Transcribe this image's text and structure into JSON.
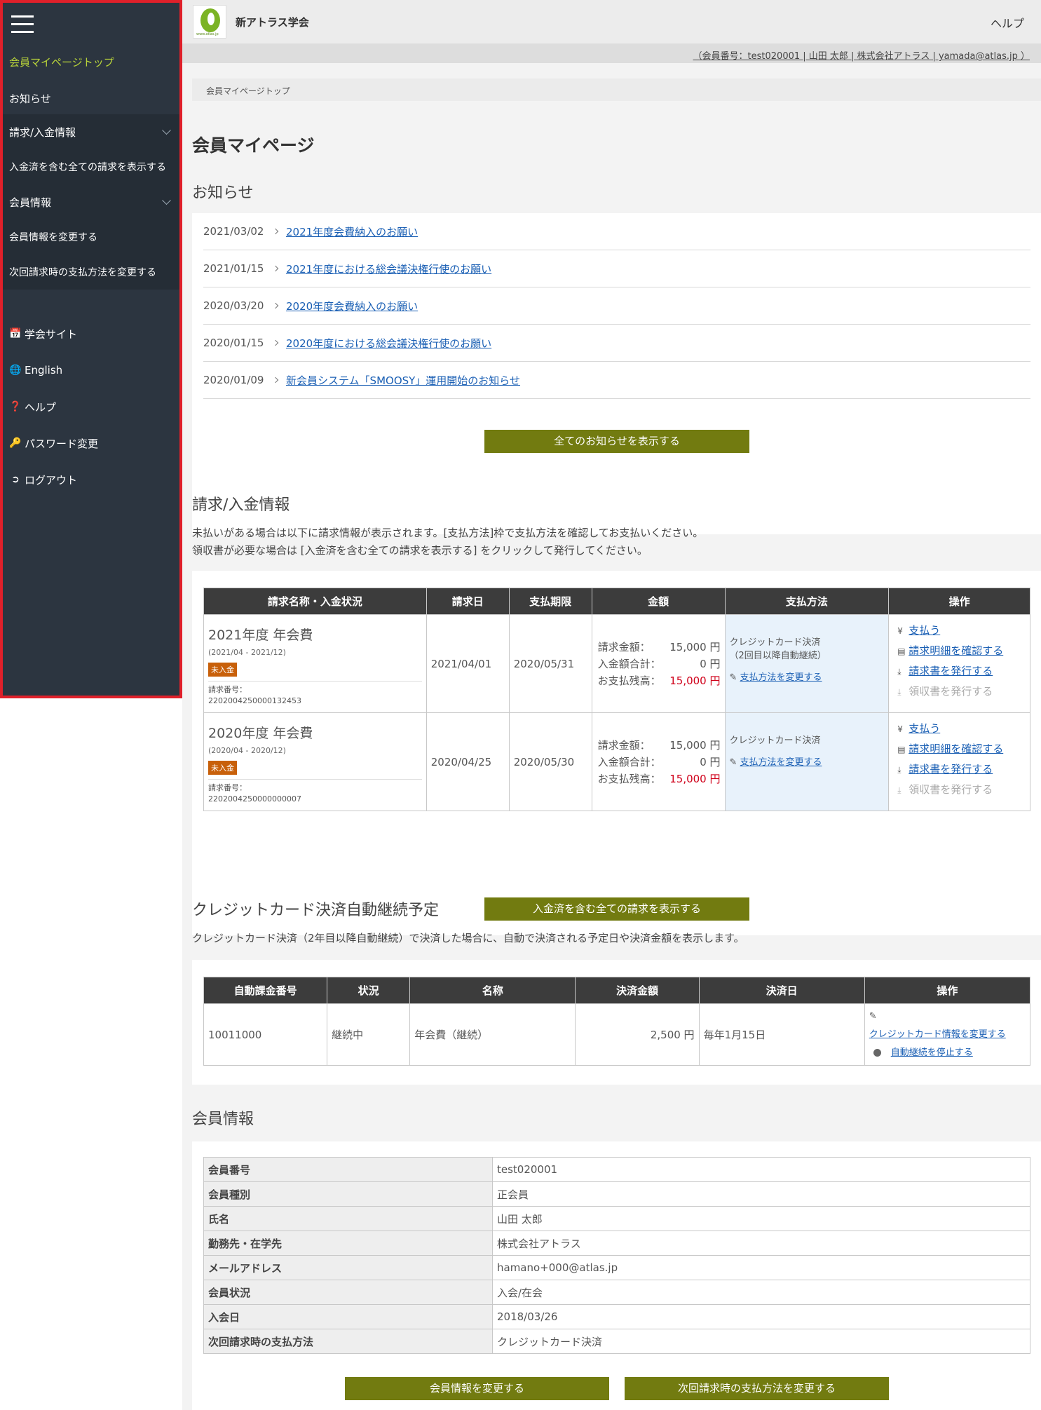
{
  "sidebar": {
    "items": [
      {
        "label": "会員マイページトップ"
      },
      {
        "label": "お知らせ"
      },
      {
        "label": "請求/入金情報"
      },
      {
        "label": "入金済を含む全ての請求を表示する"
      },
      {
        "label": "会員情報"
      },
      {
        "label": "会員情報を変更する"
      },
      {
        "label": "次回請求時の支払方法を変更する"
      }
    ],
    "links": [
      {
        "icon": "calendar-icon",
        "label": "学会サイト"
      },
      {
        "icon": "globe-icon",
        "label": "English"
      },
      {
        "icon": "question-icon",
        "label": "ヘルプ"
      },
      {
        "icon": "key-icon",
        "label": "パスワード変更"
      },
      {
        "icon": "logout-icon",
        "label": "ログアウト"
      }
    ]
  },
  "header": {
    "logo_url_text": "www.atlas.jp",
    "site_title": "新アトラス学会",
    "help": "ヘルプ",
    "user_info": "（会員番号：test020001 | 山田 太郎 | 株式会社アトラス | yamada@atlas.jp ）"
  },
  "breadcrumb": "会員マイページトップ",
  "page_title": "会員マイページ",
  "news": {
    "heading": "お知らせ",
    "items": [
      {
        "date": "2021/03/02",
        "title": "2021年度会費納入のお願い"
      },
      {
        "date": "2021/01/15",
        "title": "2021年度における総会議決権行使のお願い"
      },
      {
        "date": "2020/03/20",
        "title": "2020年度会費納入のお願い"
      },
      {
        "date": "2020/01/15",
        "title": "2020年度における総会議決権行使のお願い"
      },
      {
        "date": "2020/01/09",
        "title": "新会員システム「SMOOSY」運用開始のお知らせ"
      }
    ],
    "button": "全てのお知らせを表示する"
  },
  "billing": {
    "heading": "請求/入金情報",
    "desc1": "未払いがある場合は以下に請求情報が表示されます。[支払方法]枠で支払方法を確認してお支払いください。",
    "desc2": "領収書が必要な場合は [入金済を含む全ての請求を表示する] をクリックして発行してください。",
    "columns": [
      "請求名称・入金状況",
      "請求日",
      "支払期限",
      "金額",
      "支払方法",
      "操作"
    ],
    "amount_labels": [
      "請求金額：",
      "入金額合計：",
      "お支払残高："
    ],
    "num_label": "請求番号：",
    "change_method": "支払方法を変更する",
    "ops": [
      "支払う",
      "請求明細を確認する",
      "請求書を発行する",
      "領収書を発行する"
    ],
    "rows": [
      {
        "name": "2021年度 年会費",
        "period": "(2021/04 - 2021/12)",
        "status": "未入金",
        "number": "2202004250000132453",
        "bill_date": "2021/04/01",
        "due": "2020/05/31",
        "amount": "15,000 円",
        "paid": "0 円",
        "balance": "15,000 円",
        "method": "クレジットカード決済",
        "method_note": "（2回目以降自動継続）"
      },
      {
        "name": "2020年度 年会費",
        "period": "(2020/04 - 2020/12)",
        "status": "未入金",
        "number": "2202004250000000007",
        "bill_date": "2020/04/25",
        "due": "2020/05/30",
        "amount": "15,000 円",
        "paid": "0 円",
        "balance": "15,000 円",
        "method": "クレジットカード決済",
        "method_note": ""
      }
    ],
    "button": "入金済を含む全ての請求を表示する"
  },
  "auto": {
    "heading": "クレジットカード決済自動継続予定",
    "desc": "クレジットカード決済（2年目以降自動継続）で決済した場合に、自動で決済される予定日や決済金額を表示します。",
    "columns": [
      "自動課金番号",
      "状況",
      "名称",
      "決済金額",
      "決済日",
      "操作"
    ],
    "row": {
      "id": "10011000",
      "status": "継続中",
      "name": "年会費（継続）",
      "amount": "2,500 円",
      "date": "毎年1月15日",
      "op1": "クレジットカード情報を変更する",
      "op2": "自動継続を停止する"
    }
  },
  "member": {
    "heading": "会員情報",
    "rows": [
      {
        "k": "会員番号",
        "v": "test020001"
      },
      {
        "k": "会員種別",
        "v": "正会員"
      },
      {
        "k": "氏名",
        "v": "山田 太郎"
      },
      {
        "k": "勤務先・在学先",
        "v": "株式会社アトラス"
      },
      {
        "k": "メールアドレス",
        "v": "hamano+000@atlas.jp"
      },
      {
        "k": "会員状況",
        "v": "入会/在会"
      },
      {
        "k": "入会日",
        "v": "2018/03/26"
      },
      {
        "k": "次回請求時の支払方法",
        "v": "クレジットカード決済"
      }
    ],
    "btn_change": "会員情報を変更する",
    "btn_method": "次回請求時の支払方法を変更する"
  }
}
